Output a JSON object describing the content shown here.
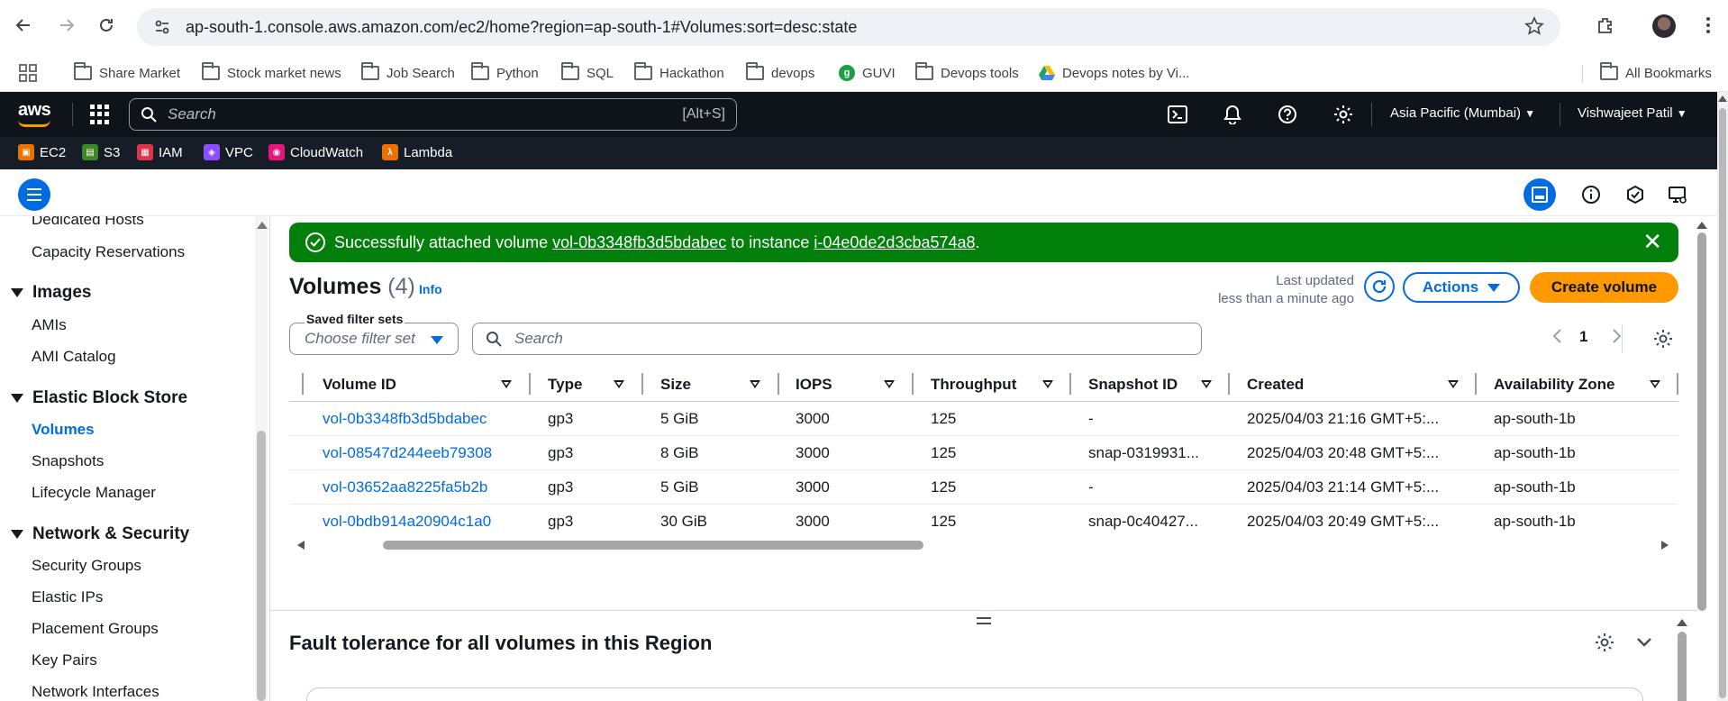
{
  "browser": {
    "url": "ap-south-1.console.aws.amazon.com/ec2/home?region=ap-south-1#Volumes:sort=desc:state",
    "bookmarks": [
      "Share Market",
      "Stock market news",
      "Job Search",
      "Python",
      "SQL",
      "Hackathon",
      "devops",
      "GUVI",
      "Devops tools",
      "Devops notes by Vi...",
      "All Bookmarks"
    ]
  },
  "aws": {
    "logo": "aws",
    "search_placeholder": "Search",
    "search_shortcut": "[Alt+S]",
    "region": "Asia Pacific (Mumbai)",
    "user": "Vishwajeet Patil",
    "favorites": [
      {
        "label": "EC2",
        "color": "#ed7100",
        "glyph": "▣"
      },
      {
        "label": "S3",
        "color": "#3f8624",
        "glyph": "▤"
      },
      {
        "label": "IAM",
        "color": "#dd344c",
        "glyph": "▦"
      },
      {
        "label": "VPC",
        "color": "#8c4fff",
        "glyph": "◈"
      },
      {
        "label": "CloudWatch",
        "color": "#e7157b",
        "glyph": "◉"
      },
      {
        "label": "Lambda",
        "color": "#ed7100",
        "glyph": "λ"
      }
    ]
  },
  "sidebar": {
    "partial_top": "Dedicated Hosts",
    "capacity": "Capacity Reservations",
    "images_head": "Images",
    "amis": "AMIs",
    "ami_catalog": "AMI Catalog",
    "ebs_head": "Elastic Block Store",
    "volumes": "Volumes",
    "snapshots": "Snapshots",
    "lifecycle": "Lifecycle Manager",
    "netsec_head": "Network & Security",
    "security_groups": "Security Groups",
    "elastic_ips": "Elastic IPs",
    "placement_groups": "Placement Groups",
    "key_pairs": "Key Pairs",
    "network_interfaces": "Network Interfaces"
  },
  "flash": {
    "prefix": "Successfully attached volume ",
    "volume_id": "vol-0b3348fb3d5bdabec",
    "middle": " to instance ",
    "instance_id": "i-04e0de2d3cba574a8",
    "suffix": ".",
    "color": "#037f0c"
  },
  "volumes": {
    "title": "Volumes",
    "count": "(4)",
    "info": "Info",
    "last_updated_label": "Last updated",
    "last_updated_value": "less than a minute ago",
    "actions": "Actions",
    "create": "Create volume",
    "filter_label": "Saved filter sets",
    "filter_placeholder": "Choose filter set",
    "search_placeholder": "Search",
    "page": "1",
    "columns": [
      "Volume ID",
      "Type",
      "Size",
      "IOPS",
      "Throughput",
      "Snapshot ID",
      "Created",
      "Availability Zone"
    ],
    "rows": [
      [
        "vol-0b3348fb3d5bdabec",
        "gp3",
        "5 GiB",
        "3000",
        "125",
        "-",
        "2025/04/03 21:16 GMT+5:...",
        "ap-south-1b"
      ],
      [
        "vol-08547d244eeb79308",
        "gp3",
        "8 GiB",
        "3000",
        "125",
        "snap-0319931...",
        "2025/04/03 20:48 GMT+5:...",
        "ap-south-1b"
      ],
      [
        "vol-03652aa8225fa5b2b",
        "gp3",
        "5 GiB",
        "3000",
        "125",
        "-",
        "2025/04/03 21:14 GMT+5:...",
        "ap-south-1b"
      ],
      [
        "vol-0bdb914a20904c1a0",
        "gp3",
        "30 GiB",
        "3000",
        "125",
        "snap-0c40427...",
        "2025/04/03 20:49 GMT+5:...",
        "ap-south-1b"
      ]
    ]
  },
  "fault": {
    "title": "Fault tolerance for all volumes in this Region"
  }
}
